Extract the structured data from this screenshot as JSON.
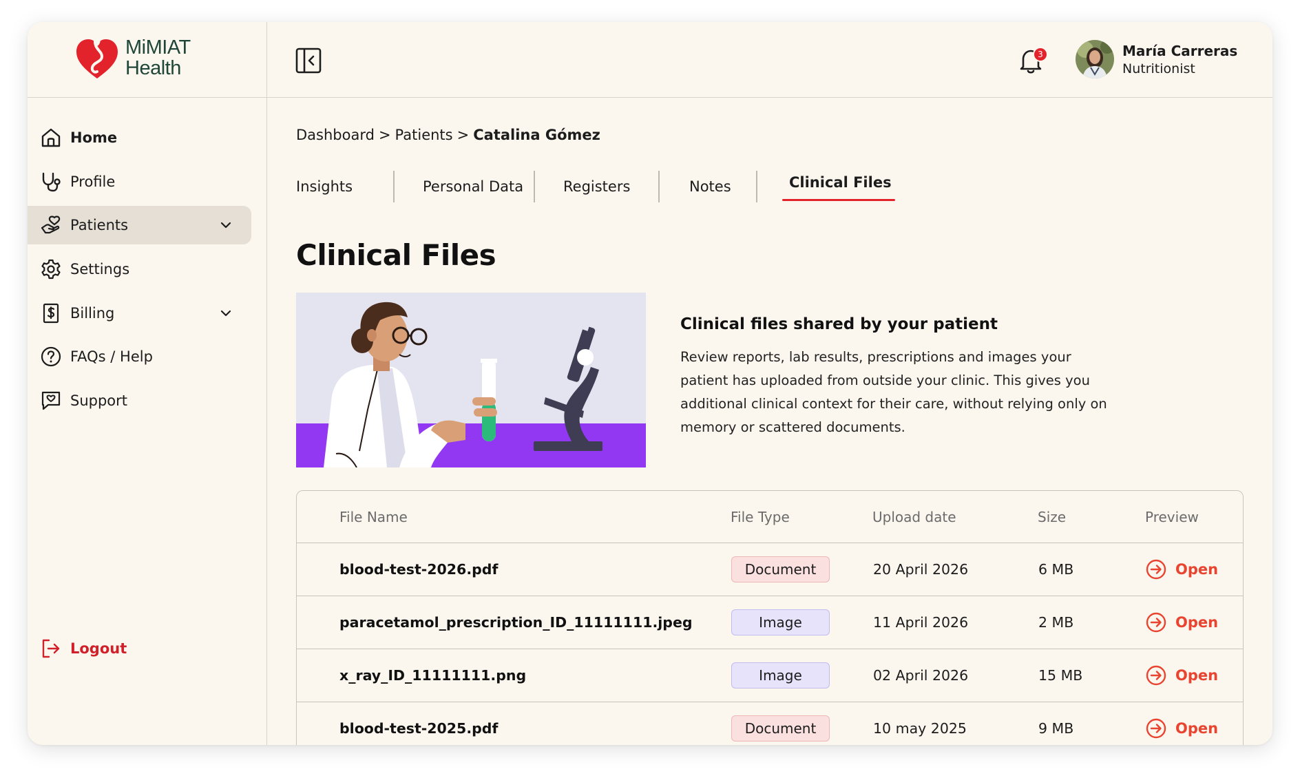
{
  "brand": {
    "name_line1": "MiMIAT",
    "name_line2": "Health",
    "primary_color": "#e3232b",
    "text_color": "#1f4638"
  },
  "header": {
    "notifications_count": "3",
    "user": {
      "name": "María Carreras",
      "role": "Nutritionist"
    }
  },
  "sidebar": {
    "items": [
      {
        "label": "Home",
        "icon": "home-icon"
      },
      {
        "label": "Profile",
        "icon": "stethoscope-icon"
      },
      {
        "label": "Patients",
        "icon": "hand-heart-icon",
        "active": true,
        "expandable": true
      },
      {
        "label": "Settings",
        "icon": "gear-icon"
      },
      {
        "label": "Billing",
        "icon": "invoice-dollar-icon",
        "expandable": true
      },
      {
        "label": "FAQs / Help",
        "icon": "question-circle-icon"
      },
      {
        "label": "Support",
        "icon": "chat-heart-icon"
      }
    ],
    "logout_label": "Logout"
  },
  "breadcrumb": {
    "items": [
      "Dashboard",
      "Patients"
    ],
    "separator": ">",
    "current": "Catalina Gómez"
  },
  "tabs": [
    {
      "label": "Insights"
    },
    {
      "label": "Personal Data"
    },
    {
      "label": "Registers"
    },
    {
      "label": "Notes"
    },
    {
      "label": "Clinical Files",
      "active": true
    }
  ],
  "page": {
    "title": "Clinical Files",
    "info_heading": "Clinical files shared by your patient",
    "info_text": "Review reports, lab results, prescriptions and images your patient has uploaded from outside your clinic. This gives you additional clinical context for their care, without relying only on memory or scattered documents."
  },
  "table": {
    "columns": [
      "File Name",
      "File Type",
      "Upload date",
      "Size",
      "Preview"
    ],
    "rows": [
      {
        "name": "blood-test-2026.pdf",
        "type": "Document",
        "date": "20 April 2026",
        "size": "6 MB",
        "action": "Open"
      },
      {
        "name": "paracetamol_prescription_ID_11111111.jpeg",
        "type": "Image",
        "date": "11 April 2026",
        "size": "2 MB",
        "action": "Open"
      },
      {
        "name": "x_ray_ID_11111111.png",
        "type": "Image",
        "date": "02 April 2026",
        "size": "15 MB",
        "action": "Open"
      },
      {
        "name": "blood-test-2025.pdf",
        "type": "Document",
        "date": "10 may 2025",
        "size": "9 MB",
        "action": "Open"
      }
    ]
  }
}
